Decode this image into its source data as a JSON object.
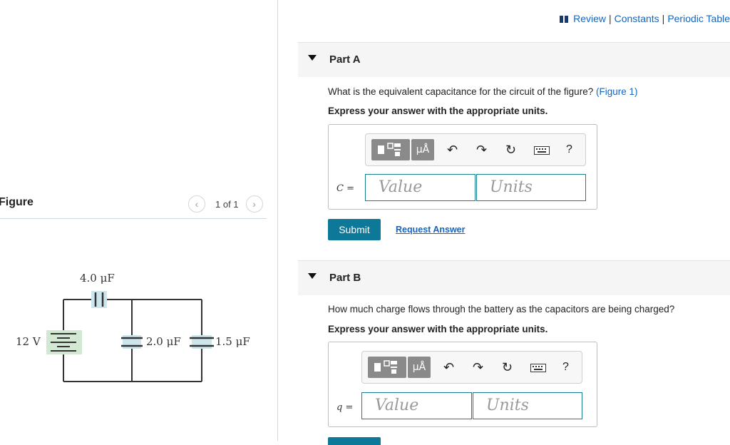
{
  "topbar": {
    "review": "Review",
    "constants": "Constants",
    "periodic": "Periodic Table",
    "sep": "|"
  },
  "figure": {
    "title": "Figure",
    "pager": "1 of 1",
    "prev_icon": "chevron-left-icon",
    "next_icon": "chevron-right-icon",
    "circuit_labels": {
      "c1": "4.0 μF",
      "c2": "2.0 μF",
      "c3": "1.5 μF",
      "battery": "12 V"
    }
  },
  "partA": {
    "title": "Part A",
    "question": "What is the equivalent capacitance for the circuit of the figure? ",
    "figure_link": "(Figure 1)",
    "instruction": "Express your answer with the appropriate units.",
    "variable": "C =",
    "value_placeholder": "Value",
    "units_placeholder": "Units",
    "submit": "Submit",
    "request": "Request Answer"
  },
  "partB": {
    "title": "Part B",
    "question": "How much charge flows through the battery as the capacitors are being charged?",
    "instruction": "Express your answer with the appropriate units.",
    "variable": "q =",
    "value_placeholder": "Value",
    "units_placeholder": "Units"
  },
  "toolbar": {
    "units_label": "μÅ",
    "help": "?",
    "icons": [
      "templates-icon",
      "units-icon",
      "undo-icon",
      "redo-icon",
      "reset-icon",
      "keyboard-icon",
      "help-icon"
    ]
  },
  "colors": {
    "accent": "#0d7897",
    "link": "#1565c0",
    "field_border": "#1a7f8c",
    "capacitor_fill": "#cde6ee"
  }
}
